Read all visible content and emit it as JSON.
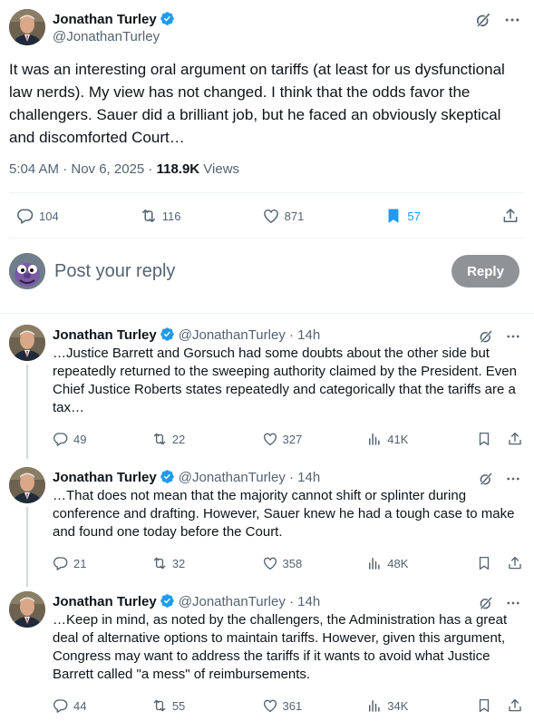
{
  "main": {
    "name": "Jonathan Turley",
    "handle": "@JonathanTurley",
    "text": "It was an interesting oral argument on tariffs (at least for us dysfunctional law nerds). My view has not changed. I think that the odds favor the challengers. Sauer did a brilliant job, but he faced an obviously skeptical and discomforted Court…",
    "time": "5:04 AM · Nov 6, 2025 · ",
    "views_count": "118.9K",
    "views_label": " Views",
    "replies": "104",
    "reposts": "116",
    "likes": "871",
    "bookmarks": "57"
  },
  "composer": {
    "placeholder": "Post your reply",
    "button": "Reply"
  },
  "replies": [
    {
      "name": "Jonathan Turley",
      "handle": "@JonathanTurley · 14h",
      "text": "…Justice Barrett and Gorsuch had some doubts about the other side but repeatedly returned to the sweeping authority claimed by the President. Even Chief Justice Roberts states repeatedly and categorically that the tariffs are a tax…",
      "replies": "49",
      "reposts": "22",
      "likes": "327",
      "views": "41K"
    },
    {
      "name": "Jonathan Turley",
      "handle": "@JonathanTurley · 14h",
      "text": "…That does not mean that the majority cannot shift or splinter during conference and drafting. However, Sauer knew he had a tough case to make and found one today before the Court.",
      "replies": "21",
      "reposts": "32",
      "likes": "358",
      "views": "48K"
    },
    {
      "name": "Jonathan Turley",
      "handle": "@JonathanTurley · 14h",
      "text": "…Keep in mind, as noted by the challengers, the Administration has a great deal of alternative options to maintain tariffs. However, given this argument, Congress may want to address the tariffs if it wants to avoid what Justice Barrett called \"a mess\" of reimbursements.",
      "replies": "44",
      "reposts": "55",
      "likes": "361",
      "views": "34K"
    }
  ],
  "colors": {
    "text": "#0f1419",
    "secondary": "#536471",
    "accent": "#1d9bf0",
    "divider": "#eff3f4",
    "reply_button": "#8f9396"
  },
  "icons": [
    "verified-icon",
    "grok-icon",
    "more-icon",
    "reply-icon",
    "repost-icon",
    "like-icon",
    "bookmark-icon",
    "views-icon",
    "share-icon"
  ]
}
